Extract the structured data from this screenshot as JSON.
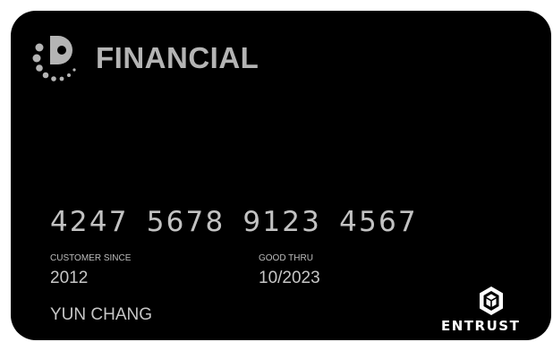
{
  "brand": {
    "name": "FINANCIAL",
    "logo_icon": "dotted-p-logo-icon",
    "color": "#b4b4b4"
  },
  "card": {
    "background": "#000000",
    "number_groups": [
      "4247",
      "5678",
      "9123",
      "4567"
    ],
    "customer_since_label": "CUSTOMER SINCE",
    "customer_since_value": "2012",
    "good_thru_label": "GOOD THRU",
    "good_thru_value": "10/2023",
    "holder_name": "YUN CHANG"
  },
  "network": {
    "name": "ENTRUST",
    "icon": "entrust-hexagon-icon"
  }
}
